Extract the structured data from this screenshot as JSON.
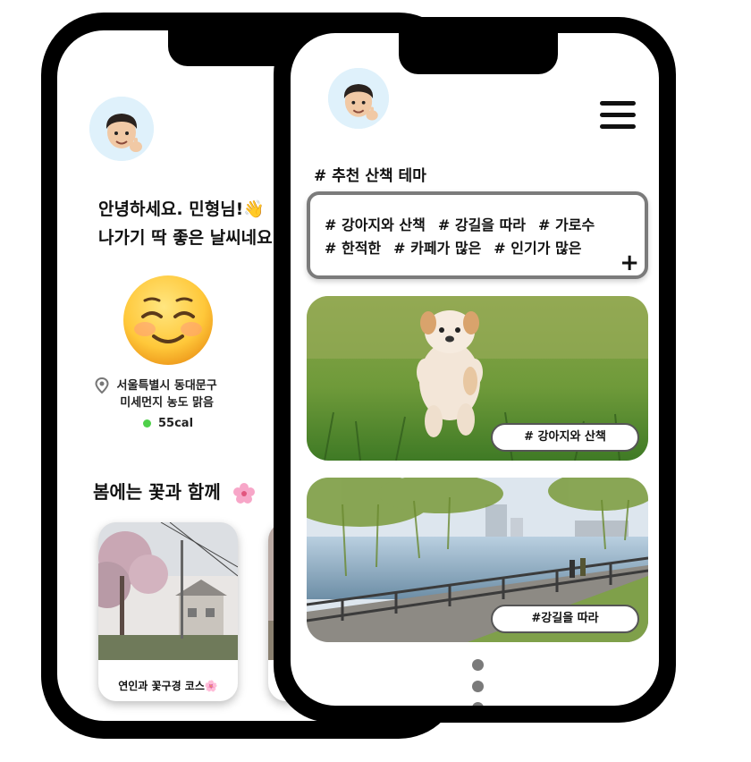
{
  "back_screen": {
    "greeting_line1": "안녕하세요. 민형님!👋",
    "greeting_line2": "나가기 딱 좋은 날씨네요",
    "location_line1": "서울특별시 동대문구",
    "location_line2": "미세먼지 농도 맑음",
    "calories": "55cal",
    "section_title": "봄에는 꽃과 함께",
    "course_card_label": "연인과 꽃구경 코스🌸",
    "icons": [
      "avatar",
      "smiling-face-icon",
      "location-pin-icon",
      "status-dot-icon",
      "cherry-blossom-icon"
    ],
    "colors": {
      "status_dot": "#4fd04a",
      "avatar_bg": "#dff1fb"
    }
  },
  "front_screen": {
    "theme_title": "# 추천 산책 테마",
    "tags_row1": [
      "# 강아지와 산책",
      "# 강길을 따라",
      "# 가로수"
    ],
    "tags_row2": [
      "# 한적한",
      "# 카페가 많은",
      "# 인기가 많은"
    ],
    "add_symbol": "+",
    "cards": [
      {
        "label": "# 강아지와 산책",
        "image": "puppy-running-on-grass"
      },
      {
        "label": "#강길을 따라",
        "image": "riverside-walkway-with-willow"
      }
    ],
    "icons": [
      "avatar",
      "hamburger-menu-icon",
      "plus-icon",
      "more-vertical-dots-icon"
    ],
    "colors": {
      "tag_box_border": "#7b7b7b",
      "dots": "#7a7a7a"
    }
  }
}
